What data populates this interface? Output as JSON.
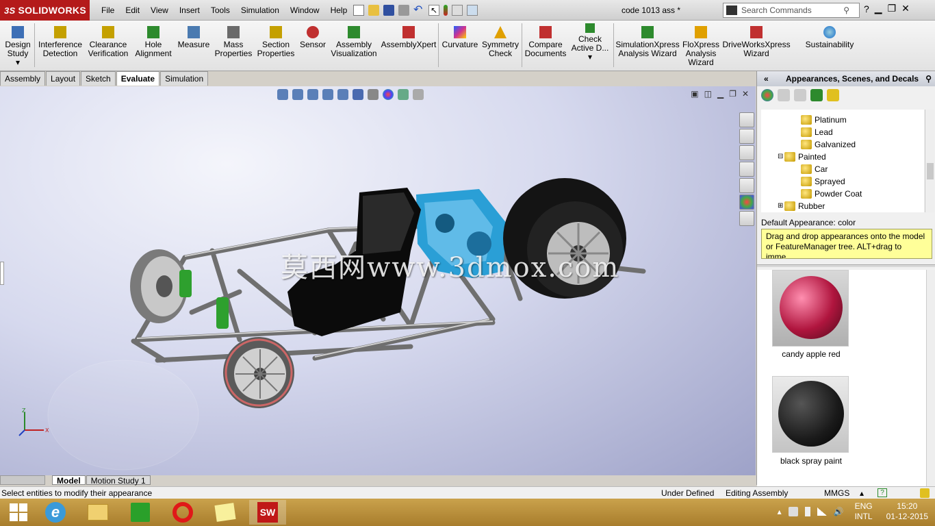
{
  "app": {
    "logo_text": "SOLIDWORKS",
    "logo_prefix": "3S",
    "document_title": "code 1013 ass *"
  },
  "menu": [
    "File",
    "Edit",
    "View",
    "Insert",
    "Tools",
    "Simulation",
    "Window",
    "Help"
  ],
  "search": {
    "placeholder": "Search Commands"
  },
  "commands": [
    {
      "label1": "Design",
      "label2": "Study",
      "icon": "design-study-icon",
      "color": "#3d6fb6"
    },
    {
      "label1": "Interference",
      "label2": "Detection",
      "icon": "interference-icon",
      "color": "#c4a000"
    },
    {
      "label1": "Clearance",
      "label2": "Verification",
      "icon": "clearance-icon",
      "color": "#c4a000"
    },
    {
      "label1": "Hole",
      "label2": "Alignment",
      "icon": "hole-alignment-icon",
      "color": "#2d8a2d"
    },
    {
      "label1": "Measure",
      "label2": "",
      "icon": "measure-icon",
      "color": "#4a7ab0"
    },
    {
      "label1": "Mass",
      "label2": "Properties",
      "icon": "mass-properties-icon",
      "color": "#6a6a6a"
    },
    {
      "label1": "Section",
      "label2": "Properties",
      "icon": "section-properties-icon",
      "color": "#c4a000"
    },
    {
      "label1": "Sensor",
      "label2": "",
      "icon": "sensor-icon",
      "color": "#c03030"
    },
    {
      "label1": "Assembly",
      "label2": "Visualization",
      "icon": "assembly-visualization-icon",
      "color": "#2d8a2d"
    },
    {
      "label1": "AssemblyXpert",
      "label2": "",
      "icon": "assemblyxpert-icon",
      "color": "#c03030"
    },
    {
      "label1": "Curvature",
      "label2": "",
      "icon": "curvature-icon",
      "color": "#d03090"
    },
    {
      "label1": "Symmetry",
      "label2": "Check",
      "icon": "symmetry-check-icon",
      "color": "#e0a000"
    },
    {
      "label1": "Compare",
      "label2": "Documents",
      "icon": "compare-documents-icon",
      "color": "#c03030"
    },
    {
      "label1": "Check",
      "label2": "Active D...",
      "icon": "check-active-icon",
      "color": "#2d8a2d"
    },
    {
      "label1": "SimulationXpress",
      "label2": "Analysis Wizard",
      "icon": "simulationxpress-icon",
      "color": "#2d8a2d"
    },
    {
      "label1": "FloXpress",
      "label2": "Analysis",
      "label3": "Wizard",
      "icon": "floxpress-icon",
      "color": "#e0a000"
    },
    {
      "label1": "DriveWorksXpress",
      "label2": "Wizard",
      "icon": "driveworksxpress-icon",
      "color": "#c03030"
    },
    {
      "label1": "Sustainability",
      "label2": "",
      "icon": "sustainability-icon",
      "color": "#3d8ad0"
    }
  ],
  "tabs": [
    "Assembly",
    "Layout",
    "Sketch",
    "Evaluate",
    "Simulation"
  ],
  "active_tab": "Evaluate",
  "viewport": {
    "watermark": "莫西网www.3dmox.com"
  },
  "task_pane": {
    "title": "Appearances, Scenes, and Decals",
    "tree": [
      {
        "label": "Platinum",
        "level": 2
      },
      {
        "label": "Lead",
        "level": 2
      },
      {
        "label": "Galvanized",
        "level": 2
      },
      {
        "label": "Painted",
        "level": 1,
        "expanded": true
      },
      {
        "label": "Car",
        "level": 2
      },
      {
        "label": "Sprayed",
        "level": 2
      },
      {
        "label": "Powder Coat",
        "level": 2
      },
      {
        "label": "Rubber",
        "level": 1,
        "expanded": false
      }
    ],
    "default_appearance": "Default Appearance: color",
    "hint": "Drag and drop appearances onto the model or FeatureManager tree.  ALT+drag to imme...",
    "swatches": [
      {
        "label": "candy apple red",
        "color": "#b0153e"
      },
      {
        "label": "black spray paint",
        "color": "#1a1a1a"
      }
    ]
  },
  "bottom_tabs": [
    "Model",
    "Motion Study 1"
  ],
  "active_bottom_tab": "Model",
  "status": {
    "message": "Select entities to modify their appearance",
    "state": "Under Defined",
    "mode": "Editing Assembly",
    "units": "MMGS"
  },
  "taskbar": {
    "apps": [
      "start-icon",
      "internet-explorer-icon",
      "file-explorer-icon",
      "store-icon",
      "opera-icon",
      "notes-icon",
      "solidworks-icon"
    ],
    "lang1": "ENG",
    "lang2": "INTL",
    "time": "15:20",
    "date": "01-12-2015"
  }
}
